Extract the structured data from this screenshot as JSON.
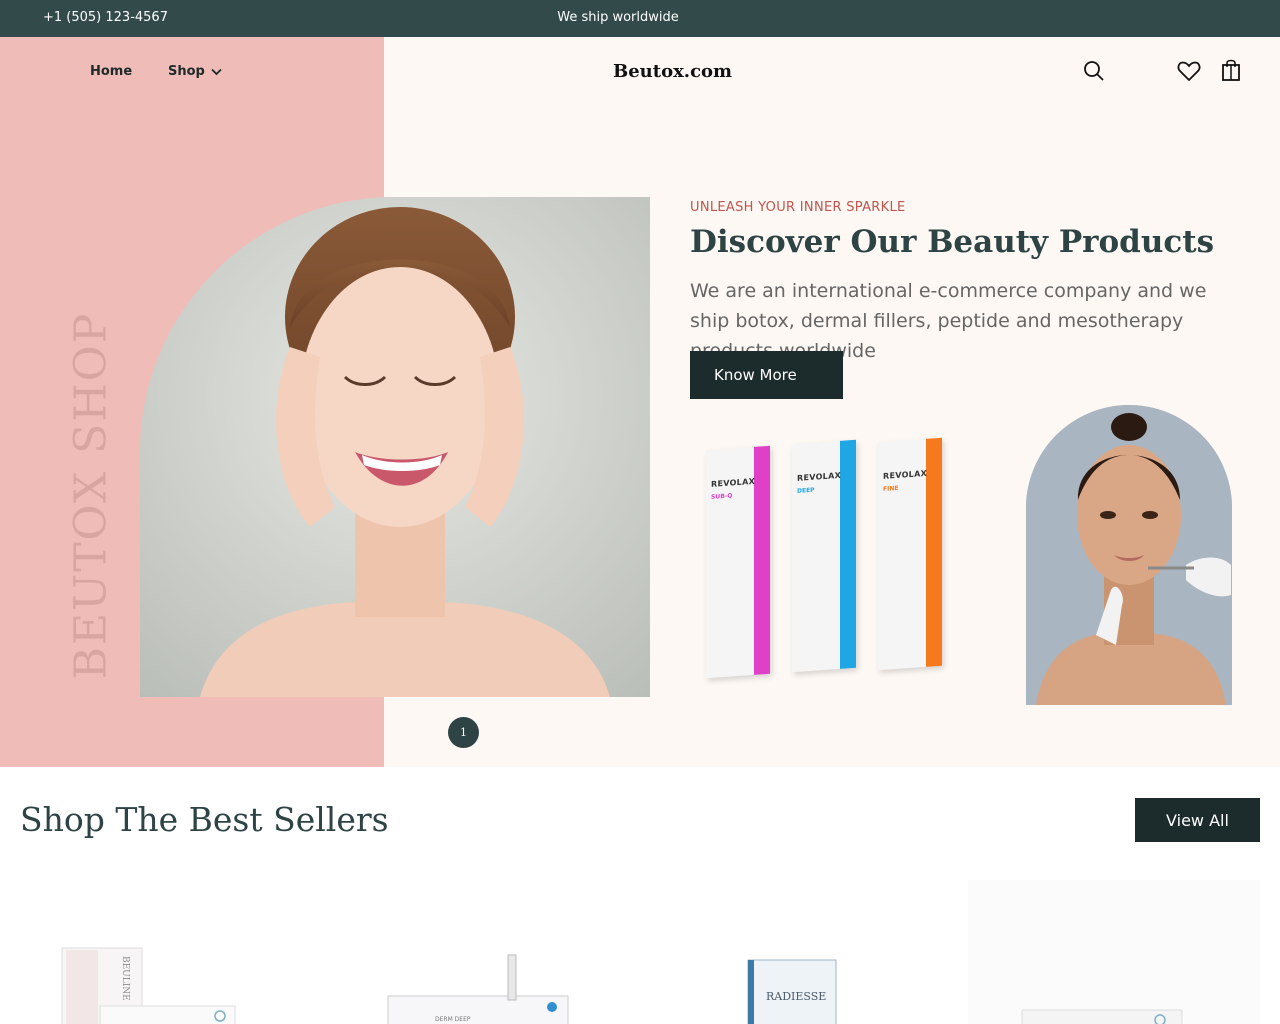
{
  "topbar": {
    "phone": "+1 (505) 123-4567",
    "announcement": "We ship worldwide"
  },
  "nav": {
    "home": "Home",
    "shop": "Shop",
    "logo": "Beutox.com",
    "icons": [
      "search-icon",
      "heart-icon",
      "shopping-bag-icon"
    ]
  },
  "hero": {
    "vertical_text": "BEUTOX SHOP",
    "eyebrow": "UNLEASH YOUR INNER SPARKLE",
    "headline": "Discover Our Beauty Products",
    "description": "We are an international e-commerce company and we ship botox, dermal fillers, peptide and mesotherapy products worldwide",
    "cta": "Know More",
    "pager_number": "1",
    "product_boxes": [
      {
        "brand": "REVOLAX",
        "variant": "SUB-Q",
        "color": "#e040c8"
      },
      {
        "brand": "REVOLAX",
        "variant": "DEEP",
        "color": "#1ea7e4"
      },
      {
        "brand": "REVOLAX",
        "variant": "FINE",
        "color": "#f57a1e"
      }
    ]
  },
  "best_sellers": {
    "title": "Shop The Best Sellers",
    "view_all": "View All",
    "product_labels": [
      "BEULINE",
      "DERM DEEP",
      "RADIESSE"
    ]
  },
  "colors": {
    "topbar": "#334a4a",
    "pink": "#efbcb7",
    "cream": "#fdf8f4",
    "accent": "#c0554d",
    "dark_button": "#1c2b2b"
  }
}
